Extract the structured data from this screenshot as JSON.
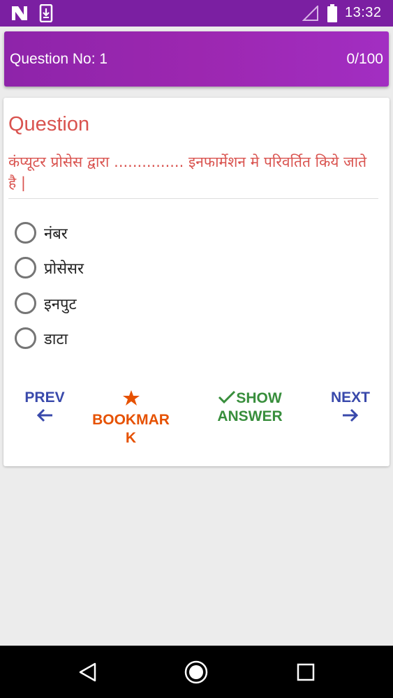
{
  "status_bar": {
    "time": "13:32",
    "icons": [
      "n-notification-icon",
      "download-icon",
      "signal-icon",
      "battery-icon"
    ]
  },
  "header": {
    "question_no": "Question No: 1",
    "progress": "0/100",
    "bg_color": "#9c27b0"
  },
  "question": {
    "heading": "Question",
    "text": "कंप्यूटर प्रोसेस द्वारा ............... इनफार्मेशन मे परिवर्तित किये जाते है |",
    "color": "#d9534f"
  },
  "options": [
    {
      "label": "नंबर"
    },
    {
      "label": "प्रोसेसर"
    },
    {
      "label": "इनपुट"
    },
    {
      "label": "डाटा"
    }
  ],
  "actions": {
    "prev_label": "PREV",
    "bookmark_label_line1": "BOOKMAR",
    "bookmark_label_line2": "K",
    "show_label_line1": "SHOW",
    "show_label_line2": "ANSWER",
    "next_label": "NEXT",
    "prev_color": "#3949ab",
    "bookmark_color": "#e65100",
    "show_color": "#388e3c",
    "next_color": "#3949ab"
  },
  "nav_bar": {
    "icons": [
      "back-icon",
      "home-icon",
      "recents-icon"
    ]
  }
}
